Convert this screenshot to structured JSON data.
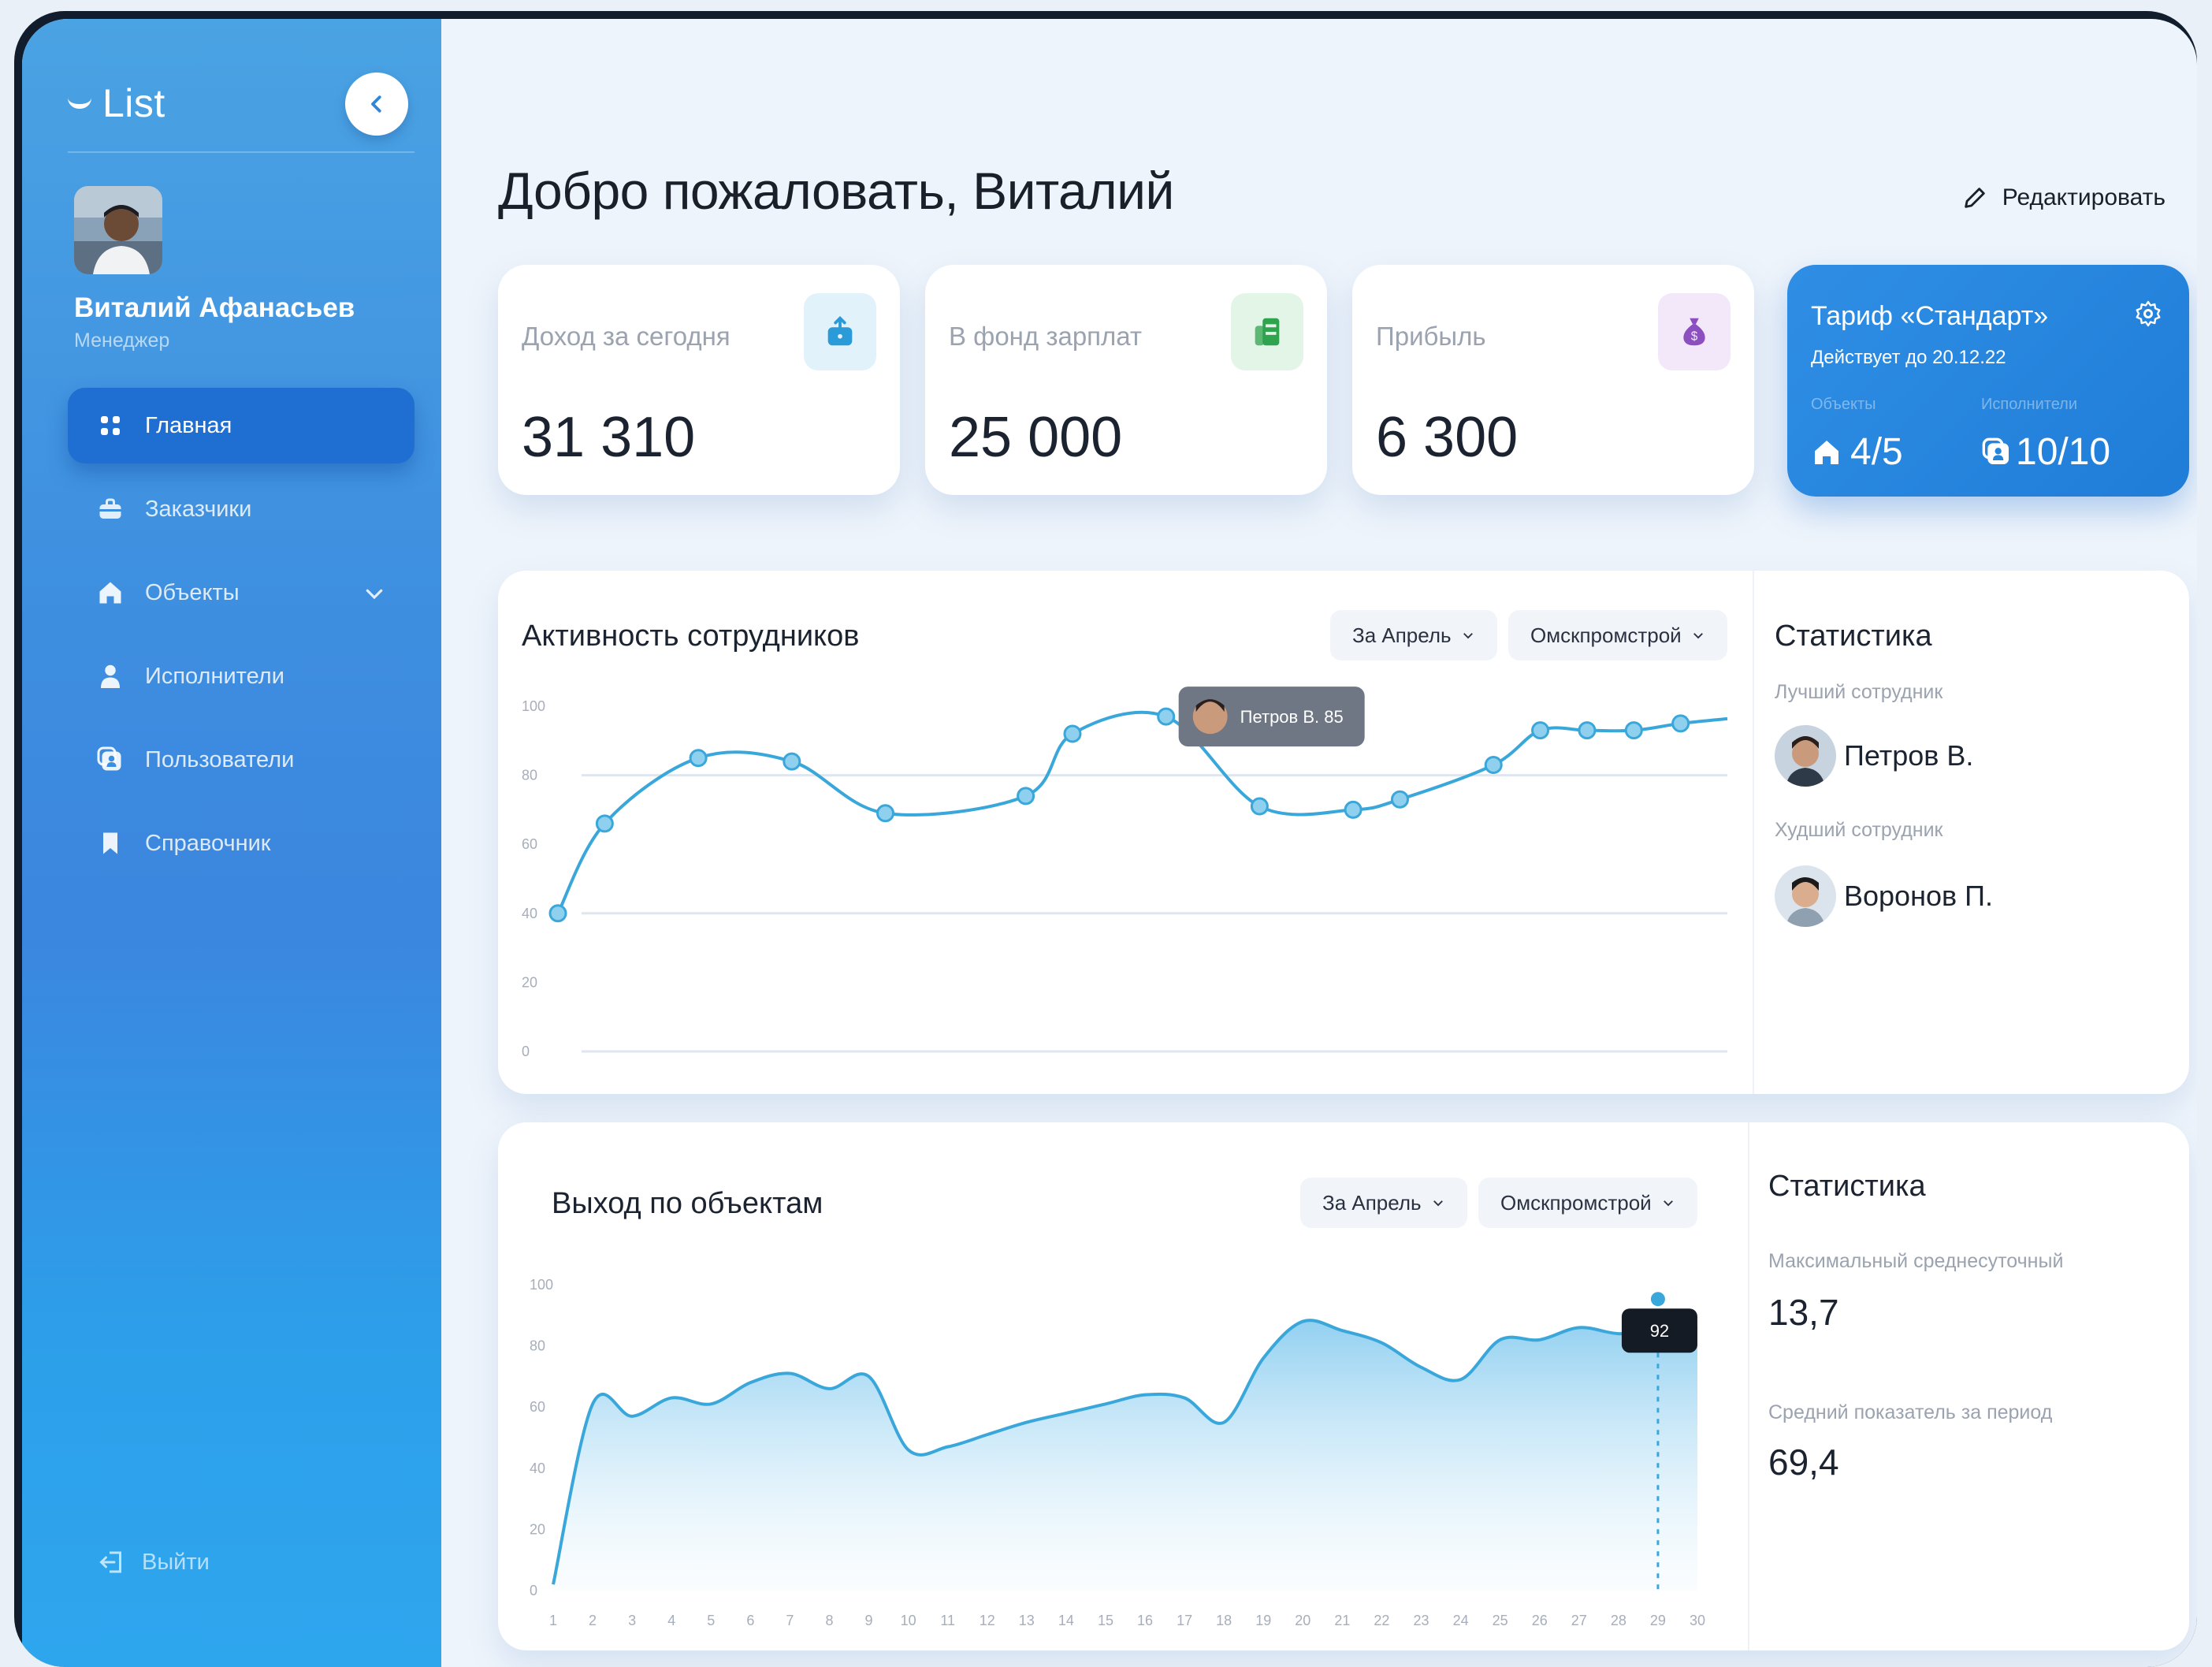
{
  "sidebar": {
    "brand": "List",
    "user": {
      "name": "Виталий Афанасьев",
      "role": "Менеджер"
    },
    "items": [
      {
        "label": "Главная",
        "icon": "grid-icon",
        "active": true
      },
      {
        "label": "Заказчики",
        "icon": "briefcase-icon"
      },
      {
        "label": "Объекты",
        "icon": "home-icon",
        "expandable": true
      },
      {
        "label": "Исполнители",
        "icon": "person-icon"
      },
      {
        "label": "Пользователи",
        "icon": "users-icon"
      },
      {
        "label": "Справочник",
        "icon": "bookmark-icon"
      }
    ],
    "logout": "Выйти"
  },
  "header": {
    "title": "Добро пожаловать, Виталий",
    "edit_label": "Редактировать"
  },
  "stat_cards": [
    {
      "label": "Доход за сегодня",
      "value": "31 310",
      "icon": "wallet-icon",
      "icon_color": "#2a9ad8",
      "icon_bg": "#e2f2fb"
    },
    {
      "label": "В фонд зарплат",
      "value": "25 000",
      "icon": "money-stack-icon",
      "icon_color": "#2fa34e",
      "icon_bg": "#e3f5e7"
    },
    {
      "label": "Прибыль",
      "value": "6 300",
      "icon": "money-bag-icon",
      "icon_color": "#8c4fc0",
      "icon_bg": "#f2e8fa"
    }
  ],
  "tariff": {
    "title": "Тариф «Стандарт»",
    "valid_until": "Действует до 20.12.22",
    "objects_label": "Объекты",
    "objects_value": "4/5",
    "executors_label": "Исполнители",
    "executors_value": "10/10"
  },
  "activity_panel": {
    "title": "Активность сотрудников",
    "filter_period": "За Апрель",
    "filter_company": "Омскпромстрой",
    "tooltip": "Петров В. 85",
    "stats_title": "Статистика",
    "best_label": "Лучший сотрудник",
    "best_name": "Петров В.",
    "worst_label": "Худший сотрудник",
    "worst_name": "Воронов П."
  },
  "output_panel": {
    "title": "Выход по объектам",
    "filter_period": "За Апрель",
    "filter_company": "Омскпромстрой",
    "tooltip": "92",
    "stats_title": "Статистика",
    "max_label": "Максимальный среднесуточный",
    "max_value": "13,7",
    "avg_label": "Средний показатель за период",
    "avg_value": "69,4"
  },
  "chart_data": [
    {
      "type": "line",
      "title": "Активность сотрудников",
      "ylim": [
        0,
        100
      ],
      "yticks": [
        0,
        20,
        40,
        60,
        80,
        100
      ],
      "color": "#3aa7db",
      "x": [
        1,
        2,
        3,
        4,
        5,
        6,
        7,
        8,
        9,
        10,
        11,
        12,
        13,
        14,
        15,
        16,
        17,
        18,
        19,
        20,
        21
      ],
      "values": [
        40,
        66,
        85,
        84,
        69,
        74,
        92,
        97,
        71,
        70,
        73,
        83,
        93,
        93,
        93,
        95
      ],
      "point_x": [
        1,
        2,
        4,
        6,
        8,
        11,
        12,
        14,
        16,
        18,
        19,
        21,
        22,
        23,
        24,
        25
      ],
      "xmax": 26,
      "highlight": {
        "x": 14,
        "label": "Петров В. 85"
      }
    },
    {
      "type": "area",
      "title": "Выход по объектам",
      "ylim": [
        0,
        100
      ],
      "yticks": [
        0,
        20,
        40,
        60,
        80,
        100
      ],
      "categories": [
        "1",
        "2",
        "3",
        "4",
        "5",
        "6",
        "7",
        "8",
        "9",
        "10",
        "11",
        "12",
        "13",
        "14",
        "15",
        "16",
        "17",
        "18",
        "19",
        "20",
        "21",
        "22",
        "23",
        "24",
        "25",
        "26",
        "27",
        "28",
        "29",
        "30"
      ],
      "color": "#3aa7db",
      "values": [
        2,
        61,
        57,
        63,
        61,
        68,
        71,
        66,
        70,
        46,
        47,
        51,
        55,
        58,
        61,
        64,
        63,
        55,
        76,
        88,
        85,
        81,
        73,
        69,
        82,
        82,
        86,
        84,
        85,
        86
      ],
      "highlight": {
        "index": 28,
        "label": "92"
      }
    }
  ]
}
